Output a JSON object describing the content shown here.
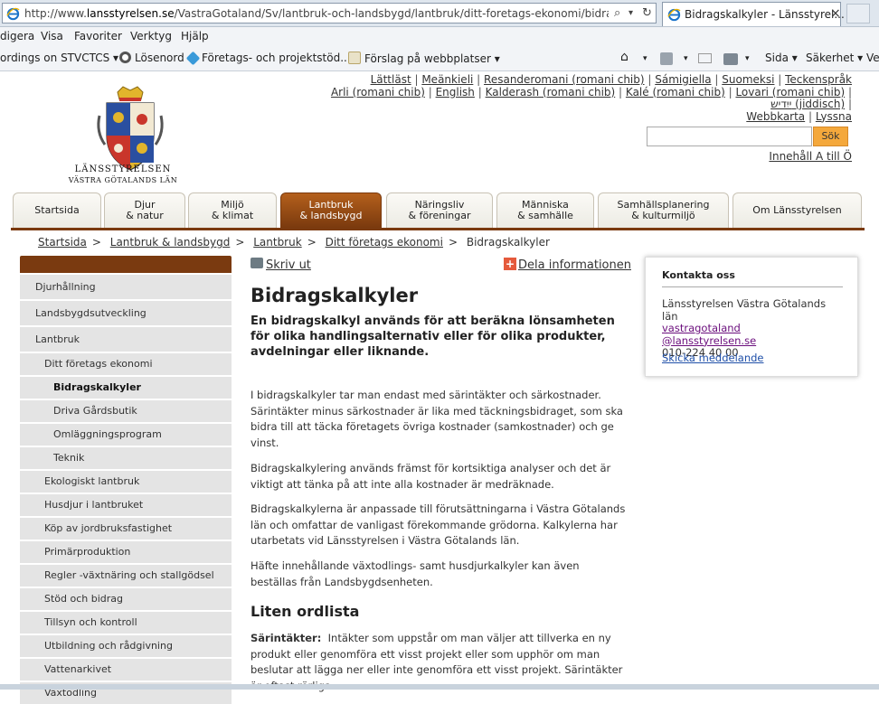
{
  "browser": {
    "url_prefix": "http://www.",
    "url_domain": "lansstyrelsen.se",
    "url_path": "/VastraGotaland/Sv/lantbruk-och-landsbygd/lantbruk/ditt-foretags-ekonomi/bidragskalkyler/l",
    "tab_title": "Bidragskalkyler - Länsstyrel...",
    "menu": [
      "digera",
      "Visa",
      "Favoriter",
      "Verktyg",
      "Hjälp"
    ],
    "favorites": [
      "ordings on STVCTCS ▾",
      "Lösenord",
      "Företags- och projektstöd...",
      "Förslag på webbplatser ▾"
    ],
    "toolbar": [
      "Sida ▾",
      "Säkerhet ▾",
      "Ve"
    ]
  },
  "header": {
    "lang_line1": [
      "Lättläst",
      "Meänkieli",
      "Resanderomani (romani chib)",
      "Sámigiella",
      "Suomeksi",
      "Teckenspråk"
    ],
    "lang_line2": [
      "Arli (romani chib)",
      "English",
      "Kalderash (romani chib)",
      "Kalé (romani chib)",
      "Lovari (romani chib)"
    ],
    "lang_line3": "ייִדיש (jiddisch)",
    "lang_line4": [
      "Webbkarta",
      "Lyssna"
    ],
    "logo_line1": "LÄNSSTYRELSEN",
    "logo_line2": "VÄSTRA GÖTALANDS LÄN",
    "search_button": "Sök",
    "contents_link": "Innehåll A till Ö"
  },
  "nav": [
    {
      "label": "Startsida"
    },
    {
      "label": "Djur\n& natur"
    },
    {
      "label": "Miljö\n& klimat"
    },
    {
      "label": "Lantbruk\n& landsbygd"
    },
    {
      "label": "Näringsliv\n& föreningar"
    },
    {
      "label": "Människa\n& samhälle"
    },
    {
      "label": "Samhällsplanering\n& kulturmiljö"
    },
    {
      "label": "Om Länsstyrelsen"
    }
  ],
  "breadcrumb": [
    "Startsida",
    "Lantbruk & landsbygd",
    "Lantbruk",
    "Ditt företags ekonomi",
    "Bidragskalkyler"
  ],
  "sidebar": [
    {
      "label": "Djurhållning"
    },
    {
      "label": "Landsbygdsutveckling"
    },
    {
      "label": "Lantbruk"
    },
    {
      "label": "Ditt företags ekonomi"
    },
    {
      "label": "Bidragskalkyler"
    },
    {
      "label": "Driva Gårdsbutik"
    },
    {
      "label": "Omläggningsprogram"
    },
    {
      "label": "Teknik"
    },
    {
      "label": "Ekologiskt lantbruk"
    },
    {
      "label": "Husdjur i lantbruket"
    },
    {
      "label": "Köp av jordbruksfastighet"
    },
    {
      "label": "Primärproduktion"
    },
    {
      "label": "Regler -växtnäring och stallgödsel"
    },
    {
      "label": "Stöd och bidrag"
    },
    {
      "label": "Tillsyn och kontroll"
    },
    {
      "label": "Utbildning och rådgivning"
    },
    {
      "label": "Vattenarkivet"
    },
    {
      "label": "Växtodling"
    }
  ],
  "main": {
    "print": "Skriv ut",
    "share": "Dela informationen",
    "title": "Bidragskalkyler",
    "lead": "En bidragskalkyl används för att beräkna lönsamheten för olika handlingsalternativ eller för olika produkter, avdelningar eller liknande.",
    "p1": "I bidragskalkyler tar man endast med särintäkter och särkostnader. Särintäkter minus särkostnader är lika med täckningsbidraget, som ska bidra till att täcka företagets övriga kostnader (samkostnader) och ge vinst.",
    "p2": "Bidragskalkylering används främst för kortsiktiga analyser och det är viktigt att tänka på att inte alla kostnader är medräknade.",
    "p3": "Bidragskalkylerna är anpassade till förutsättningarna i Västra Götalands län och omfattar de vanligast förekommande grödorna. Kalkylerna har utarbetats vid Länsstyrelsen i Västra Götalands län.",
    "p4": "Häfte innehållande växtodlings- samt husdjurkalkyler kan även beställas från Landsbygdsenheten.",
    "h2": "Liten ordlista",
    "term": "Särintäkter:",
    "term_def": "Intäkter som uppstår om man väljer att tillverka en ny produkt eller genomföra ett visst projekt eller som upphör om man beslutar att lägga ner eller inte genomföra ett visst projekt. Särintäkter är oftast rörliga."
  },
  "contact": {
    "heading": "Kontakta oss",
    "org": "Länsstyrelsen Västra Götalands län",
    "email1": "vastragotaland",
    "email2": "@lansstyrelsen.se",
    "phone": "010-224 40 00",
    "send": "Skicka meddelande"
  },
  "colors": {
    "brand": "#7a3a10",
    "search_button": "#f4a83c",
    "link_visited": "#6a0d7c"
  }
}
